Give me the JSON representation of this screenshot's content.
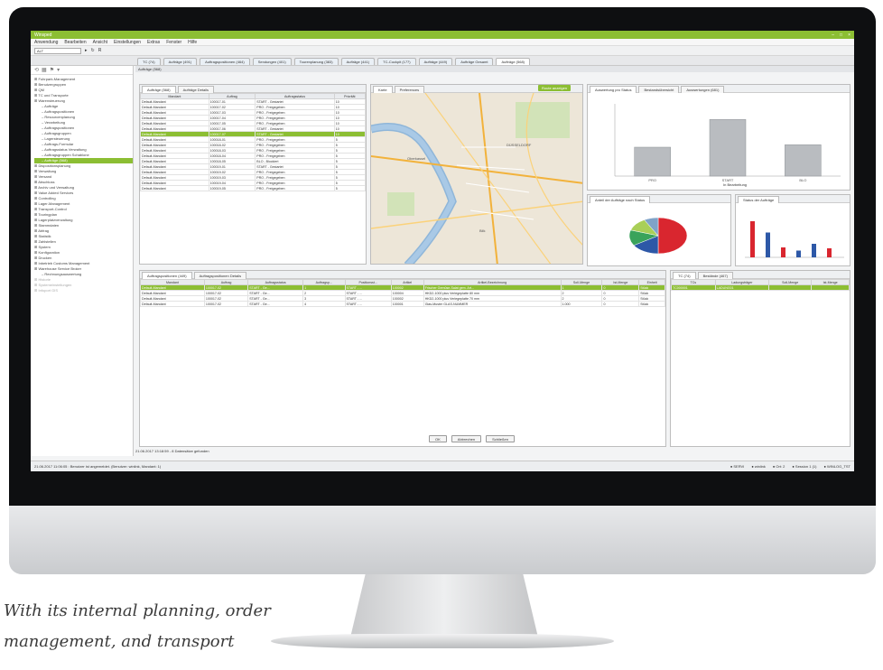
{
  "app": {
    "title": "Winsped",
    "win_controls": [
      "–",
      "□",
      "×"
    ]
  },
  "menu": [
    "Anwendung",
    "Bearbeiten",
    "Ansicht",
    "Einstellungen",
    "Extras",
    "Fenster",
    "Hilfe"
  ],
  "toolbar": {
    "combo_value": "ALT"
  },
  "tabs": [
    "TC (74)",
    "Aufträge (491)",
    "Auftragspositionen (464)",
    "Sendungen (401)",
    "Tourenplanung (383)",
    "Aufträge (441)",
    "TC-Cockpit (177)",
    "Aufträge (449)",
    "Aufträge Gesamt",
    "Aufträge (568)"
  ],
  "sidebar": {
    "tools": [
      "⟲",
      "▦",
      "⚑",
      "▾"
    ],
    "items": [
      {
        "label": "Fuhrpark-Management",
        "indent": false
      },
      {
        "label": "Benutzergruppen",
        "indent": false
      },
      {
        "label": "QM",
        "indent": false
      },
      {
        "label": "TC und Transporte",
        "indent": false
      },
      {
        "label": "Warensteuerung",
        "indent": false
      },
      {
        "label": "Aufträge",
        "indent": true
      },
      {
        "label": "Auftragspositionen",
        "indent": true
      },
      {
        "label": "Resourcenplanung",
        "indent": true
      },
      {
        "label": "Verarbeitung",
        "indent": true
      },
      {
        "label": "Auftragspositionen",
        "indent": true
      },
      {
        "label": "Auftragsgruppen",
        "indent": true
      },
      {
        "label": "Lagersteuerung",
        "indent": true
      },
      {
        "label": "Auftrags-Formular",
        "indent": true
      },
      {
        "label": "Auftragsstatus Verwaltung",
        "indent": true
      },
      {
        "label": "Auftragsgruppen Schablone",
        "indent": true
      },
      {
        "label": "Aufträge (568)",
        "indent": true,
        "selected": true
      },
      {
        "label": "Dispositionsplanung",
        "indent": false
      },
      {
        "label": "Verwaltung",
        "indent": false
      },
      {
        "label": "Versand",
        "indent": false
      },
      {
        "label": "Abschluss",
        "indent": false
      },
      {
        "label": "Archiv und Verwaltung",
        "indent": false
      },
      {
        "label": "Value Added Services",
        "indent": false
      },
      {
        "label": "Controlling",
        "indent": false
      },
      {
        "label": "Lager-Management",
        "indent": false
      },
      {
        "label": "Transport-Control",
        "indent": false
      },
      {
        "label": "Touringplan",
        "indent": false
      },
      {
        "label": "Lagerplatzverwaltung",
        "indent": false
      },
      {
        "label": "Stammdaten",
        "indent": false
      },
      {
        "label": "Abfrag",
        "indent": false
      },
      {
        "label": "Statistik",
        "indent": false
      },
      {
        "label": "Zahlstellen",
        "indent": false
      },
      {
        "label": "System",
        "indent": false
      },
      {
        "label": "Konfiguration",
        "indent": false
      },
      {
        "label": "Drucken",
        "indent": false
      },
      {
        "label": "Inbetrieb Customs Management",
        "indent": false
      },
      {
        "label": "Warehouse Service Broker",
        "indent": false
      },
      {
        "label": "Rechnungsauswertung",
        "indent": true
      },
      {
        "label": "Historie",
        "indent": false,
        "dim": true
      },
      {
        "label": "Systemeinstellungen",
        "indent": false,
        "dim": true
      },
      {
        "label": "Infoport GIS",
        "indent": false,
        "dim": true
      }
    ]
  },
  "main_header": "Aufträge (568)",
  "orders_panel": {
    "tabs": [
      "Aufträge (568)",
      "Aufträge Details"
    ],
    "columns": [
      "Mandant",
      "Auftrag",
      "Auftragsstatus",
      "Priorität"
    ],
    "rows": [
      [
        "Default-Mandant",
        "100017-01",
        "START - Gestartet",
        "10"
      ],
      [
        "Default-Mandant",
        "100017-02",
        "PRO - Freigegeben",
        "10"
      ],
      [
        "Default-Mandant",
        "100017-03",
        "PRO - Freigegeben",
        "10"
      ],
      [
        "Default-Mandant",
        "100017-04",
        "PRO - Freigegeben",
        "10"
      ],
      [
        "Default-Mandant",
        "100017-05",
        "PRO - Freigegeben",
        "10"
      ],
      [
        "Default-Mandant",
        "100017-06",
        "START - Gestartet",
        "10"
      ],
      [
        "Default-Mandant",
        "100017-07",
        "START - Gestartet",
        "10"
      ],
      [
        "Default-Mandant",
        "100018-01",
        "PRO - Freigegeben",
        "5"
      ],
      [
        "Default-Mandant",
        "100018-02",
        "PRO - Freigegeben",
        "5"
      ],
      [
        "Default-Mandant",
        "100018-03",
        "PRO - Freigegeben",
        "5"
      ],
      [
        "Default-Mandant",
        "100018-04",
        "PRO - Freigegeben",
        "5"
      ],
      [
        "Default-Mandant",
        "100018-05",
        "BLO - Blockiert",
        "5"
      ],
      [
        "Default-Mandant",
        "100019-01",
        "START - Gestartet",
        "5"
      ],
      [
        "Default-Mandant",
        "100019-02",
        "PRO - Freigegeben",
        "5"
      ],
      [
        "Default-Mandant",
        "100019-03",
        "PRO - Freigegeben",
        "5"
      ],
      [
        "Default-Mandant",
        "100019-04",
        "PRO - Freigegeben",
        "5"
      ],
      [
        "Default-Mandant",
        "100019-05",
        "PRO - Freigegeben",
        "5"
      ]
    ],
    "selected_row": 6
  },
  "map_panel": {
    "tabs": [
      "Karte",
      "Preferences"
    ],
    "button": "Route anzeigen",
    "labels": [
      "DÜSSELDORF",
      "Oberkassel",
      "Bilk"
    ]
  },
  "chart_panel": {
    "tabs": [
      "Auswertung pro Status",
      "Bestandsübersicht",
      "Auswertungen (681)"
    ],
    "button": "Gesamt",
    "tooltip": "In Bearbeitung"
  },
  "chart_data": [
    {
      "type": "bar",
      "categories": [
        "PRO",
        "START",
        "BLO"
      ],
      "values": [
        120,
        235,
        130
      ],
      "ylim": [
        0,
        300
      ]
    },
    {
      "type": "pie",
      "categories": [
        "PRO",
        "START",
        "BLO",
        "OK",
        "Sonstige"
      ],
      "values": [
        50,
        16,
        14,
        12,
        8
      ],
      "colors": [
        "#d9262f",
        "#2d58a7",
        "#3aa35b",
        "#a9cf58",
        "#7fa3c8"
      ]
    },
    {
      "type": "bar",
      "categories": [
        "A",
        "B",
        "C",
        "D",
        "E",
        "F"
      ],
      "values": [
        80,
        55,
        22,
        15,
        30,
        20
      ],
      "colors": [
        "#d9262f",
        "#2d58a7",
        "#d9262f",
        "#2d58a7",
        "#2d58a7",
        "#d9262f"
      ],
      "ylim": [
        0,
        100
      ]
    }
  ],
  "pie_panel": {
    "title": "Anteil der Aufträge nach Status"
  },
  "small_chart_panel": {
    "title": "Status der Aufträge"
  },
  "positions_panel": {
    "tabs": [
      "Auftragspositionen (449)",
      "Auftragspositionen Details"
    ],
    "columns": [
      "Mandant",
      "Auftrag",
      "Auftragsstatus",
      "Auftragsp...",
      "Positionsst...",
      "Artikel",
      "Artikel-Bezeichnung",
      "Soll-Menge",
      "Ist-Menge",
      "Einheit"
    ],
    "rows": [
      [
        "Default-Mandant",
        "100017-02",
        "START - Ge...",
        "1",
        "START - ...",
        "100002",
        "Frischer Gemüse-Salat gem. Art...",
        "1",
        "0",
        "Stück"
      ],
      [
        "Default-Mandant",
        "100017-02",
        "START - Ge...",
        "2",
        "START - ...",
        "100004",
        "HKD2-1000 plus Verlegeplatte 80 mm",
        "2",
        "0",
        "Stück"
      ],
      [
        "Default-Mandant",
        "100017-02",
        "START - Ge...",
        "3",
        "START - ...",
        "100002",
        "HKD2-1000 plus Verlegeplatte 70 mm",
        "2",
        "0",
        "Stück"
      ],
      [
        "Default-Mandant",
        "100017-02",
        "START - Ge...",
        "4",
        "START - ...",
        "100001",
        "Glas-Muster GLAS-NUMMER",
        "1.000",
        "0",
        "Stück"
      ]
    ],
    "selected_row": 0,
    "buttons": [
      "OK",
      "Abbrechen",
      "Schließen"
    ]
  },
  "tc_panel": {
    "tabs": [
      "TC (74)",
      "Bestände (467)"
    ],
    "columns": [
      "TCs",
      "Ladungsträger",
      "Soll-Menge",
      "Ist-Menge"
    ],
    "rows": [
      [
        "TC000001",
        "LADUNG01",
        "",
        ""
      ]
    ]
  },
  "status": {
    "info": "21.06.2017 13:18:59 - 8 Datensätze gefunden",
    "left": "21.06.2017 11:06:05 : Benutzer ist angemeldet. (Benutzer: winlink, Mandant: 1)",
    "items": [
      "SERVI",
      "winlink",
      "Ort: 2",
      "Session 1 (1)",
      "WINLOG_TST"
    ]
  },
  "caption": [
    "With its internal planning, order",
    "management, and transport"
  ]
}
